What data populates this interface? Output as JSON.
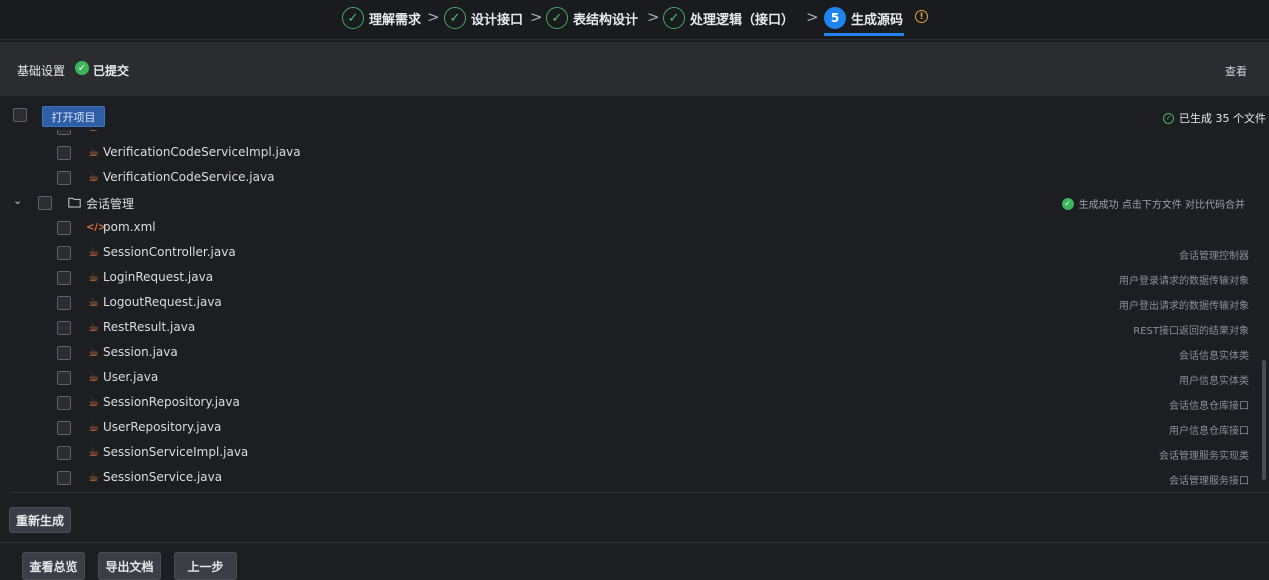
{
  "stepper": {
    "steps": [
      {
        "label": "理解需求",
        "state": "done"
      },
      {
        "label": "设计接口",
        "state": "done"
      },
      {
        "label": "表结构设计",
        "state": "done"
      },
      {
        "label": "处理逻辑（接口）",
        "state": "done"
      },
      {
        "label": "生成源码",
        "state": "active",
        "number": "5"
      }
    ],
    "separator": ">",
    "check_glyph": "✓",
    "info_glyph": "!"
  },
  "section": {
    "title": "基础设置",
    "status": "已提交",
    "view_link": "查看"
  },
  "toolbar": {
    "open_project": "打开项目",
    "generated_status": "已生成 35 个文件"
  },
  "tree": {
    "rows": [
      {
        "kind": "file",
        "icon": "java-icon",
        "name": "VerificationCodeServiceImpl.java",
        "desc": ""
      },
      {
        "kind": "file",
        "icon": "java-icon",
        "name": "VerificationCodeService.java",
        "desc": ""
      },
      {
        "kind": "folder",
        "icon": "folder-icon",
        "name": "会话管理",
        "desc": "生成成功  点击下方文件 对比代码合并"
      },
      {
        "kind": "file",
        "icon": "xml-icon",
        "name": "pom.xml",
        "desc": ""
      },
      {
        "kind": "file",
        "icon": "java-icon",
        "name": "SessionController.java",
        "desc": "会话管理控制器"
      },
      {
        "kind": "file",
        "icon": "java-icon",
        "name": "LoginRequest.java",
        "desc": "用户登录请求的数据传输对象"
      },
      {
        "kind": "file",
        "icon": "java-icon",
        "name": "LogoutRequest.java",
        "desc": "用户登出请求的数据传输对象"
      },
      {
        "kind": "file",
        "icon": "java-icon",
        "name": "RestResult.java",
        "desc": "REST接口返回的结果对象"
      },
      {
        "kind": "file",
        "icon": "java-icon",
        "name": "Session.java",
        "desc": "会话信息实体类"
      },
      {
        "kind": "file",
        "icon": "java-icon",
        "name": "User.java",
        "desc": "用户信息实体类"
      },
      {
        "kind": "file",
        "icon": "java-icon",
        "name": "SessionRepository.java",
        "desc": "会话信息仓库接口"
      },
      {
        "kind": "file",
        "icon": "java-icon",
        "name": "UserRepository.java",
        "desc": "用户信息仓库接口"
      },
      {
        "kind": "file",
        "icon": "java-icon",
        "name": "SessionServiceImpl.java",
        "desc": "会话管理服务实现类"
      },
      {
        "kind": "file",
        "icon": "java-icon",
        "name": "SessionService.java",
        "desc": "会话管理服务接口"
      }
    ]
  },
  "buttons": {
    "regenerate": "重新生成",
    "overview": "查看总览",
    "export_doc": "导出文档",
    "previous": "上一步"
  },
  "colors": {
    "accent": "#1f84f0",
    "success": "#3cb65a",
    "java_icon": "#d8763e",
    "warning": "#e3a63a"
  }
}
